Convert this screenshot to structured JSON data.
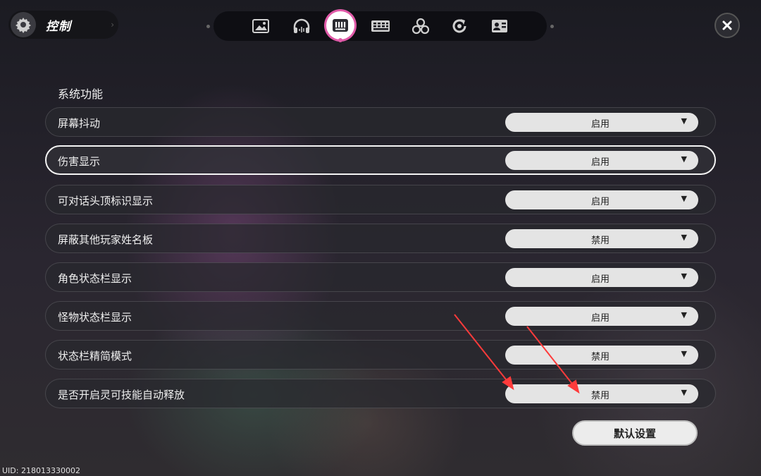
{
  "header": {
    "title": "控制",
    "title_icon": "gear-icon",
    "tabs": [
      {
        "icon": "image-icon",
        "active": false
      },
      {
        "icon": "headphones-icon",
        "active": false
      },
      {
        "icon": "keyboard-icon",
        "active": true
      },
      {
        "icon": "grid-icon",
        "active": false
      },
      {
        "icon": "circles-icon",
        "active": false
      },
      {
        "icon": "refresh-icon",
        "active": false
      },
      {
        "icon": "id-card-icon",
        "active": false
      }
    ],
    "close_icon": "close-icon",
    "accent_color": "#e05aa8"
  },
  "section": {
    "title": "系统功能",
    "rows": [
      {
        "label": "屏幕抖动",
        "value": "启用"
      },
      {
        "label": "伤害显示",
        "value": "启用",
        "selected": true
      },
      {
        "label": "可对话头顶标识显示",
        "value": "启用"
      },
      {
        "label": "屏蔽其他玩家姓名板",
        "value": "禁用"
      },
      {
        "label": "角色状态栏显示",
        "value": "启用"
      },
      {
        "label": "怪物状态栏显示",
        "value": "启用"
      },
      {
        "label": "状态栏精简模式",
        "value": "禁用"
      },
      {
        "label": "是否开启灵可技能自动释放",
        "value": "禁用"
      }
    ],
    "dropdown_arrow": "▼"
  },
  "footer": {
    "default_button": "默认设置",
    "uid": "UID: 218013330002"
  },
  "annotation": {
    "arrow_color": "#ff3b3b"
  }
}
